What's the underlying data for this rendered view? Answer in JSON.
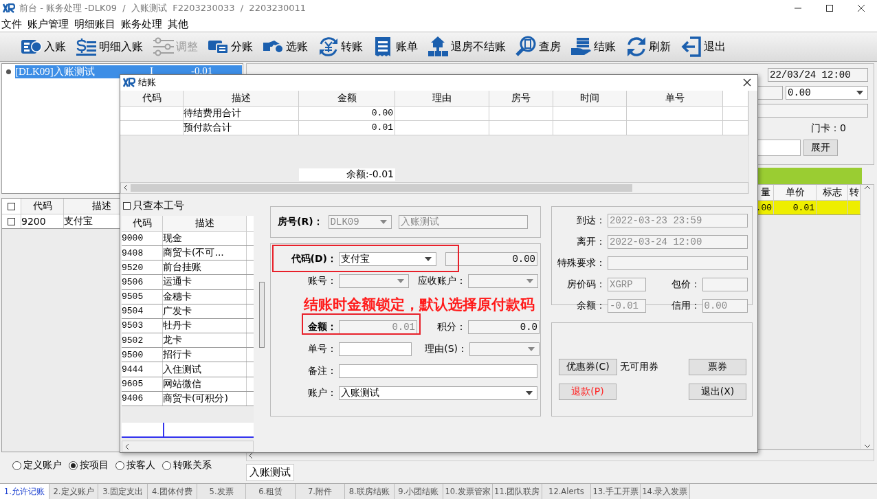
{
  "window": {
    "title": "前台 - 账务处理 -DLK09  /  入账测试  F2203230033  /  2203230011"
  },
  "menu": [
    "文件",
    "账户管理",
    "明细账目",
    "账务处理",
    "其他"
  ],
  "toolbar": [
    {
      "label": "入账",
      "kind": "cash",
      "disabled": false
    },
    {
      "label": "明细入账",
      "kind": "list",
      "disabled": false
    },
    {
      "label": "调整",
      "kind": "sliders",
      "disabled": true
    },
    {
      "label": "分账",
      "kind": "split",
      "disabled": false
    },
    {
      "label": "选账",
      "kind": "hand",
      "disabled": false
    },
    {
      "label": "转账",
      "kind": "cycle",
      "disabled": false
    },
    {
      "label": "账单",
      "kind": "bill",
      "disabled": false
    },
    {
      "label": "退房不结账",
      "kind": "house",
      "disabled": false
    },
    {
      "label": "查房",
      "kind": "search",
      "disabled": false
    },
    {
      "label": "结账",
      "kind": "money",
      "disabled": false
    },
    {
      "label": "刷新",
      "kind": "refresh",
      "disabled": false
    },
    {
      "label": "退出",
      "kind": "exit",
      "disabled": false
    }
  ],
  "account_list": [
    {
      "label": "[DLK09]入账测试",
      "flag": "I",
      "amount": "-0.01",
      "selected": true
    }
  ],
  "item_table": {
    "header_checked": false,
    "columns": [
      "代码",
      "描述"
    ],
    "rows": [
      {
        "code": "9200",
        "description": "支付宝",
        "checked": false
      }
    ]
  },
  "view_options": [
    {
      "label": "定义账户",
      "selected": false
    },
    {
      "label": "按项目",
      "selected": true
    },
    {
      "label": "按客人",
      "selected": false
    },
    {
      "label": "转账关系",
      "selected": false
    }
  ],
  "guest_info": {
    "departure": "22/03/24 12:00",
    "deposit": "0.00",
    "card": "门卡：0",
    "expand_button": "展开"
  },
  "charges_table": {
    "columns": [
      "量",
      "单价",
      "标志",
      "转"
    ],
    "rows": [
      {
        "cells": [
          ".00",
          "0.01"
        ]
      }
    ]
  },
  "account_tab": "入账测试",
  "status_tabs": [
    {
      "label": "1.允许记账",
      "selected": true
    },
    {
      "label": "2.定义账户",
      "selected": false
    },
    {
      "label": "3.固定支出",
      "selected": false
    },
    {
      "label": "4.团体付费",
      "selected": false
    },
    {
      "label": "5.发票",
      "selected": false
    },
    {
      "label": "6.租赁",
      "selected": false
    },
    {
      "label": "7.附件",
      "selected": false
    },
    {
      "label": "8.联房结账",
      "selected": false
    },
    {
      "label": "9.小团结账",
      "selected": false
    },
    {
      "label": "10.发票管家",
      "selected": false
    },
    {
      "label": "11.团队联房",
      "selected": false
    },
    {
      "label": "12.Alerts",
      "selected": false
    },
    {
      "label": "13.手工开票",
      "selected": false
    },
    {
      "label": "14.录入发票",
      "selected": false
    }
  ],
  "checkout_dialog": {
    "title": "结账",
    "summary_table": {
      "columns": [
        "代码",
        "描述",
        "金额",
        "理由",
        "房号",
        "时间",
        "单号"
      ],
      "rows": [
        {
          "description": "待结费用合计",
          "amount": "0.00"
        },
        {
          "description": "预付款合计",
          "amount": "0.01"
        }
      ],
      "balance": "余额:-0.01"
    },
    "own_only": {
      "label": "只查本工号",
      "checked": false
    },
    "payment_codes": {
      "columns": [
        "代码",
        "描述"
      ],
      "rows": [
        {
          "code": "9000",
          "description": "现金"
        },
        {
          "code": "9408",
          "description": "商贸卡(不可..."
        },
        {
          "code": "9520",
          "description": "前台挂账"
        },
        {
          "code": "9506",
          "description": "运通卡"
        },
        {
          "code": "9505",
          "description": "金穗卡"
        },
        {
          "code": "9504",
          "description": "广发卡"
        },
        {
          "code": "9503",
          "description": "牡丹卡"
        },
        {
          "code": "9502",
          "description": "龙卡"
        },
        {
          "code": "9500",
          "description": "招行卡"
        },
        {
          "code": "9444",
          "description": "入住测试"
        },
        {
          "code": "9605",
          "description": "网站微信"
        },
        {
          "code": "9406",
          "description": "商贸卡(可积分)"
        }
      ]
    },
    "room": {
      "label": "房号(R)：",
      "code": "DLK09",
      "name": "入账测试"
    },
    "payment": {
      "code_label": "代码(D)：",
      "code": "支付宝",
      "code_amount": "0.00",
      "account_no_label": "账号：",
      "receivable_label": "应收账户：",
      "annotation": "结账时金额锁定，默认选择原付款码",
      "amount_label": "金额：",
      "amount": "0.01",
      "points_label": "积分：",
      "points": "0.0",
      "bill_no_label": "单号：",
      "reason_label": "理由(S)：",
      "remark_label": "备注：",
      "account_label": "账户：",
      "account": "入账测试"
    },
    "stay": {
      "arrival_label": "到达：",
      "arrival": "2022-03-23 23:59",
      "departure_label": "离开：",
      "departure": "2022-03-24 12:00",
      "special_label": "特殊要求：",
      "rate_label": "房价码：",
      "rate": "XGRP",
      "package_label": "包价：",
      "balance_label": "余额：",
      "balance": "-0.01",
      "credit_label": "信用：",
      "credit": "0.00"
    },
    "actions": {
      "coupon": "优惠券(C)",
      "coupon_note": "无可用券",
      "ticket": "票券",
      "refund": "退款(P)",
      "exit": "退出(X)"
    }
  }
}
